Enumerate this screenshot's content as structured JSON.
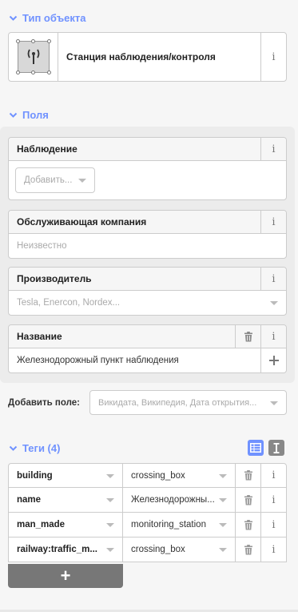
{
  "preset_section": {
    "title": "Тип объекта",
    "preset_name": "Станция наблюдения/контроля",
    "preset_icon": "antenna-broadcast-icon"
  },
  "fields_section": {
    "title": "Поля",
    "fields": [
      {
        "label": "Наблюдение",
        "add_placeholder": "Добавить..."
      },
      {
        "label": "Обслуживающая компания",
        "placeholder": "Неизвестно"
      },
      {
        "label": "Производитель",
        "placeholder": "Tesla, Enercon, Nordex..."
      },
      {
        "label": "Название",
        "value": "Железнодорожный пункт наблюдения"
      }
    ],
    "add_field_label": "Добавить поле:",
    "add_field_placeholder": "Викидата, Википедия, Дата открытия..."
  },
  "tags_section": {
    "title": "Теги (4)",
    "tags": [
      {
        "key": "building",
        "value": "crossing_box"
      },
      {
        "key": "name",
        "value": "Железнодорожны..."
      },
      {
        "key": "man_made",
        "value": "monitoring_station"
      },
      {
        "key": "railway:traffic_m...",
        "value": "crossing_box"
      }
    ],
    "add_tag_label": "+"
  },
  "colors": {
    "accent": "#7092ff",
    "add_tag_bg": "#777777",
    "panel_bg": "#ececec"
  }
}
